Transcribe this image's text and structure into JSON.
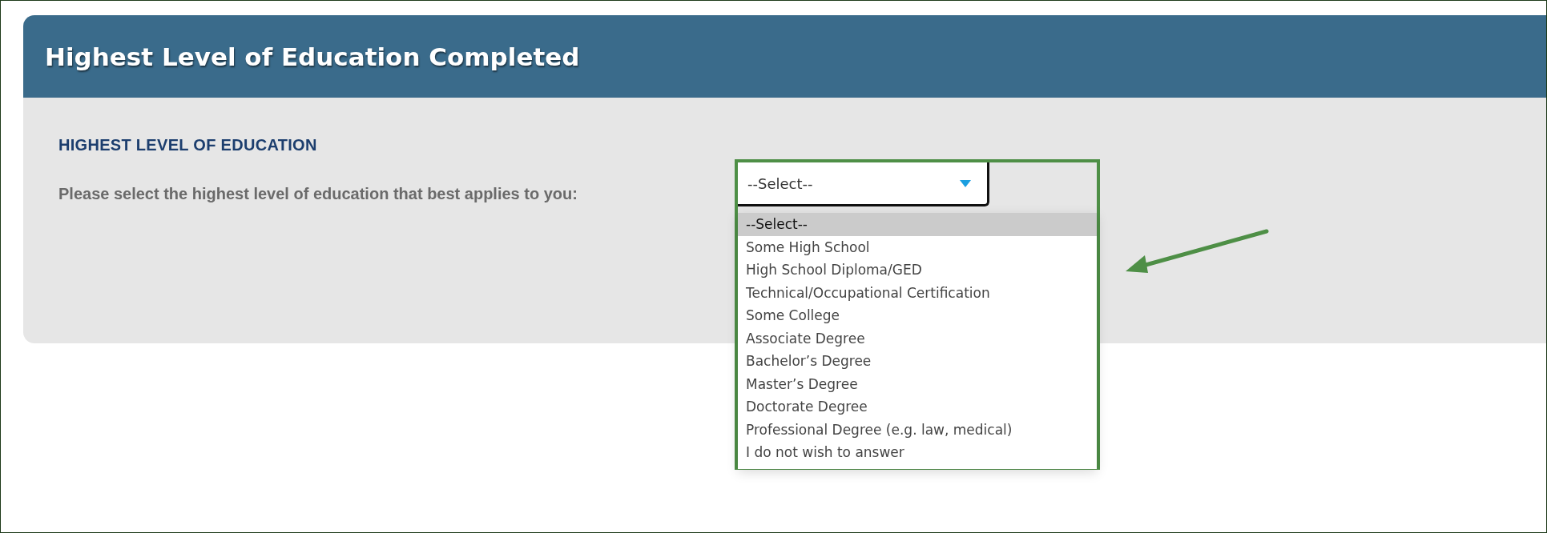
{
  "panel": {
    "title": "Highest Level of Education Completed"
  },
  "section": {
    "heading": "HIGHEST LEVEL OF EDUCATION",
    "question": "Please select the highest level of education that best applies to you:"
  },
  "select": {
    "value": "--Select--"
  },
  "options": [
    {
      "label": "--Select--",
      "selected": true
    },
    {
      "label": "Some High School",
      "selected": false
    },
    {
      "label": "High School Diploma/GED",
      "selected": false
    },
    {
      "label": "Technical/Occupational Certification",
      "selected": false
    },
    {
      "label": "Some College",
      "selected": false
    },
    {
      "label": "Associate Degree",
      "selected": false
    },
    {
      "label": "Bachelor’s Degree",
      "selected": false
    },
    {
      "label": "Master’s Degree",
      "selected": false
    },
    {
      "label": "Doctorate Degree",
      "selected": false
    },
    {
      "label": "Professional Degree (e.g. law, medical)",
      "selected": false
    },
    {
      "label": "I do not wish to answer",
      "selected": false
    }
  ]
}
